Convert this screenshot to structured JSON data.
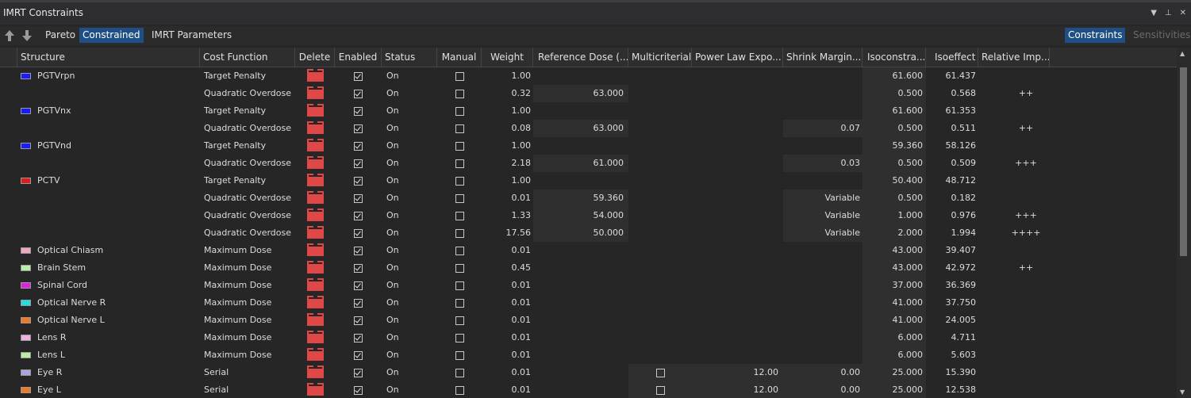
{
  "window": {
    "title": "IMRT Constraints"
  },
  "toolbar": {
    "pareto": "Pareto",
    "constrained": "Constrained",
    "imrt_parameters": "IMRT Parameters",
    "constraints": "Constraints",
    "sensitivities": "Sensitivities"
  },
  "columns": {
    "structure": "Structure",
    "cost_function": "Cost Function",
    "delete": "Delete",
    "enabled": "Enabled",
    "status": "Status",
    "manual": "Manual",
    "weight": "Weight",
    "reference_dose": "Reference Dose (...",
    "multicriterial": "Multicriterial",
    "power_law": "Power Law Expo...",
    "shrink_margin": "Shrink Margin...",
    "isoconstraint": "Isoconstra...",
    "isoeffect": "Isoeffect",
    "relative_imp": "Relative Imp..."
  },
  "colors": {
    "accent": "#1f4f85",
    "delete": "#e04848"
  },
  "rows": [
    {
      "structure": "PGTVrpn",
      "swatch": "#1a1aff",
      "cost": "Target Penalty",
      "enabled": true,
      "status": "On",
      "manual": false,
      "weight": "1.00",
      "ref": "",
      "multi": null,
      "power": "",
      "shrink": "",
      "iso": "61.600",
      "isoeffect": "61.437",
      "rel": ""
    },
    {
      "structure": "",
      "swatch": "",
      "cost": "Quadratic Overdose",
      "enabled": true,
      "status": "On",
      "manual": false,
      "weight": "0.32",
      "ref": "63.000",
      "multi": null,
      "power": "",
      "shrink": "",
      "iso": "0.500",
      "isoeffect": "0.568",
      "rel": "++"
    },
    {
      "structure": "PGTVnx",
      "swatch": "#1a1aff",
      "cost": "Target Penalty",
      "enabled": true,
      "status": "On",
      "manual": false,
      "weight": "1.00",
      "ref": "",
      "multi": null,
      "power": "",
      "shrink": "",
      "iso": "61.600",
      "isoeffect": "61.353",
      "rel": ""
    },
    {
      "structure": "",
      "swatch": "",
      "cost": "Quadratic Overdose",
      "enabled": true,
      "status": "On",
      "manual": false,
      "weight": "0.08",
      "ref": "63.000",
      "multi": null,
      "power": "",
      "shrink": "0.07",
      "iso": "0.500",
      "isoeffect": "0.511",
      "rel": "++"
    },
    {
      "structure": "PGTVnd",
      "swatch": "#1a1aff",
      "cost": "Target Penalty",
      "enabled": true,
      "status": "On",
      "manual": false,
      "weight": "1.00",
      "ref": "",
      "multi": null,
      "power": "",
      "shrink": "",
      "iso": "59.360",
      "isoeffect": "58.126",
      "rel": ""
    },
    {
      "structure": "",
      "swatch": "",
      "cost": "Quadratic Overdose",
      "enabled": true,
      "status": "On",
      "manual": false,
      "weight": "2.18",
      "ref": "61.000",
      "multi": null,
      "power": "",
      "shrink": "0.03",
      "iso": "0.500",
      "isoeffect": "0.509",
      "rel": "+++"
    },
    {
      "structure": "PCTV",
      "swatch": "#e01b1b",
      "cost": "Target Penalty",
      "enabled": true,
      "status": "On",
      "manual": false,
      "weight": "1.00",
      "ref": "",
      "multi": null,
      "power": "",
      "shrink": "",
      "iso": "50.400",
      "isoeffect": "48.712",
      "rel": ""
    },
    {
      "structure": "",
      "swatch": "",
      "cost": "Quadratic Overdose",
      "enabled": true,
      "status": "On",
      "manual": false,
      "weight": "0.01",
      "ref": "59.360",
      "multi": null,
      "power": "",
      "shrink": "Variable",
      "iso": "0.500",
      "isoeffect": "0.182",
      "rel": ""
    },
    {
      "structure": "",
      "swatch": "",
      "cost": "Quadratic Overdose",
      "enabled": true,
      "status": "On",
      "manual": false,
      "weight": "1.33",
      "ref": "54.000",
      "multi": null,
      "power": "",
      "shrink": "Variable",
      "iso": "1.000",
      "isoeffect": "0.976",
      "rel": "+++"
    },
    {
      "structure": "",
      "swatch": "",
      "cost": "Quadratic Overdose",
      "enabled": true,
      "status": "On",
      "manual": false,
      "weight": "17.56",
      "ref": "50.000",
      "multi": null,
      "power": "",
      "shrink": "Variable",
      "iso": "2.000",
      "isoeffect": "1.994",
      "rel": "++++"
    },
    {
      "structure": "Optical Chiasm",
      "swatch": "#f0a8c0",
      "cost": "Maximum Dose",
      "enabled": true,
      "status": "On",
      "manual": false,
      "weight": "0.01",
      "ref": "",
      "multi": null,
      "power": "",
      "shrink": "",
      "iso": "43.000",
      "isoeffect": "39.407",
      "rel": ""
    },
    {
      "structure": "Brain Stem",
      "swatch": "#b8f0a8",
      "cost": "Maximum Dose",
      "enabled": true,
      "status": "On",
      "manual": false,
      "weight": "0.45",
      "ref": "",
      "multi": null,
      "power": "",
      "shrink": "",
      "iso": "43.000",
      "isoeffect": "42.972",
      "rel": "++"
    },
    {
      "structure": "Spinal Cord",
      "swatch": "#e020e0",
      "cost": "Maximum Dose",
      "enabled": true,
      "status": "On",
      "manual": false,
      "weight": "0.01",
      "ref": "",
      "multi": null,
      "power": "",
      "shrink": "",
      "iso": "37.000",
      "isoeffect": "36.369",
      "rel": ""
    },
    {
      "structure": "Optical Nerve R",
      "swatch": "#20e0e0",
      "cost": "Maximum Dose",
      "enabled": true,
      "status": "On",
      "manual": false,
      "weight": "0.01",
      "ref": "",
      "multi": null,
      "power": "",
      "shrink": "",
      "iso": "41.000",
      "isoeffect": "37.750",
      "rel": ""
    },
    {
      "structure": "Optical Nerve L",
      "swatch": "#f07820",
      "cost": "Maximum Dose",
      "enabled": true,
      "status": "On",
      "manual": false,
      "weight": "0.01",
      "ref": "",
      "multi": null,
      "power": "",
      "shrink": "",
      "iso": "41.000",
      "isoeffect": "24.005",
      "rel": ""
    },
    {
      "structure": "Lens R",
      "swatch": "#f0b0e0",
      "cost": "Maximum Dose",
      "enabled": true,
      "status": "On",
      "manual": false,
      "weight": "0.01",
      "ref": "",
      "multi": null,
      "power": "",
      "shrink": "",
      "iso": "6.000",
      "isoeffect": "4.711",
      "rel": ""
    },
    {
      "structure": "Lens L",
      "swatch": "#b8f0a8",
      "cost": "Maximum Dose",
      "enabled": true,
      "status": "On",
      "manual": false,
      "weight": "0.01",
      "ref": "",
      "multi": null,
      "power": "",
      "shrink": "",
      "iso": "6.000",
      "isoeffect": "5.603",
      "rel": ""
    },
    {
      "structure": "Eye R",
      "swatch": "#b0a0e0",
      "cost": "Serial",
      "enabled": true,
      "status": "On",
      "manual": false,
      "weight": "0.01",
      "ref": "",
      "multi": false,
      "power": "12.00",
      "shrink": "0.00",
      "iso": "25.000",
      "isoeffect": "15.390",
      "rel": ""
    },
    {
      "structure": "Eye L",
      "swatch": "#f07820",
      "cost": "Serial",
      "enabled": true,
      "status": "On",
      "manual": false,
      "weight": "0.01",
      "ref": "",
      "multi": false,
      "power": "12.00",
      "shrink": "0.00",
      "iso": "25.000",
      "isoeffect": "12.538",
      "rel": ""
    }
  ]
}
